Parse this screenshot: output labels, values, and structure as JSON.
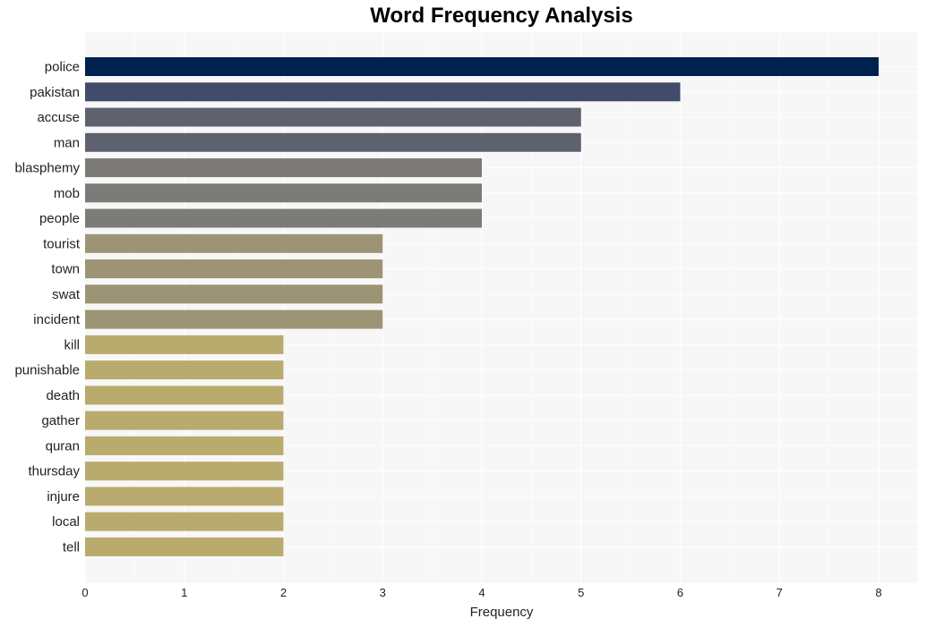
{
  "chart_data": {
    "type": "bar",
    "orientation": "horizontal",
    "title": "Word Frequency Analysis",
    "xlabel": "Frequency",
    "ylabel": "",
    "xlim": [
      0,
      8.4
    ],
    "xticks": [
      0,
      1,
      2,
      3,
      4,
      5,
      6,
      7,
      8
    ],
    "grid": true,
    "categories": [
      "police",
      "pakistan",
      "accuse",
      "man",
      "blasphemy",
      "mob",
      "people",
      "tourist",
      "town",
      "swat",
      "incident",
      "kill",
      "punishable",
      "death",
      "gather",
      "quran",
      "thursday",
      "injure",
      "local",
      "tell"
    ],
    "values": [
      8,
      6,
      5,
      5,
      4,
      4,
      4,
      3,
      3,
      3,
      3,
      2,
      2,
      2,
      2,
      2,
      2,
      2,
      2,
      2
    ],
    "colors": {
      "8": "#00204e",
      "6": "#414c6b",
      "5": "#5e626e",
      "4": "#7c7b78",
      "3": "#9c9474",
      "2": "#b9ab6e"
    },
    "background": "#f7f7f7"
  }
}
